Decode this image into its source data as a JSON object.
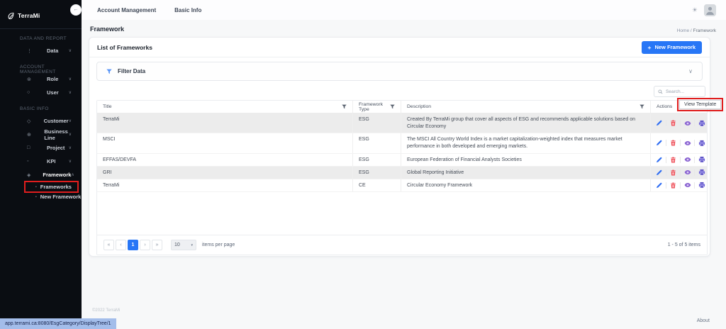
{
  "colors": {
    "accent": "#2776f6",
    "annotation": "#e01e1e",
    "edit": "#2f6df2",
    "delete": "#ee4b55",
    "view": "#8a63d2",
    "print": "#5f54c7",
    "status_bg": "#a3bdea"
  },
  "icons": {
    "collapse": "←",
    "theme": "☀",
    "chevron_down": "∨",
    "chevron_up": "∧",
    "filter_chevron": "∨",
    "caret": "▾",
    "scroll_up": "▲",
    "scroll_down": "▼",
    "sub_bullet": "•"
  },
  "sidebar": {
    "logo": "TerraMi",
    "sections": [
      {
        "label": "DATA AND REPORT",
        "items": [
          {
            "label": "Data",
            "icon": "data-icon",
            "glyph": "⋮",
            "chevron": "down"
          }
        ]
      },
      {
        "label": "ACCOUNT MANAGEMENT",
        "items": [
          {
            "label": "Role",
            "icon": "role-icon",
            "glyph": "⊚",
            "chevron": "down"
          },
          {
            "label": "User",
            "icon": "user-icon",
            "glyph": "○",
            "chevron": "down"
          }
        ]
      },
      {
        "label": "BASIC INFO",
        "items": [
          {
            "label": "Customer",
            "icon": "customer-icon",
            "glyph": "◇",
            "chevron": "down"
          },
          {
            "label": "Business Line",
            "icon": "business-line-icon",
            "glyph": "⊕",
            "chevron": "down"
          },
          {
            "label": "Project",
            "icon": "project-icon",
            "glyph": "□",
            "chevron": "down"
          },
          {
            "label": "KPI",
            "icon": "kpi-icon",
            "glyph": "◦",
            "chevron": "down"
          },
          {
            "label": "Framework",
            "icon": "framework-icon",
            "glyph": "◈",
            "chevron": "up",
            "active": true,
            "children": [
              {
                "label": "Frameworks",
                "annotated": true
              },
              {
                "label": "New Framework"
              }
            ]
          }
        ]
      }
    ]
  },
  "topbar": {
    "menu": [
      {
        "label": "Account Management"
      },
      {
        "label": "Basic Info"
      }
    ]
  },
  "page": {
    "title": "Framework",
    "breadcrumb_home": "Home",
    "breadcrumb_sep": " / ",
    "breadcrumb_current": "Framework"
  },
  "card": {
    "title": "List of Frameworks",
    "new_button_plus": "+",
    "new_button_label": "New Framework"
  },
  "filter": {
    "label": "Filter Data"
  },
  "search": {
    "placeholder": "Search..."
  },
  "table": {
    "columns": [
      {
        "label": "Title",
        "filter": true
      },
      {
        "label": "Framework Type",
        "filter": true
      },
      {
        "label": "Description",
        "filter": true
      },
      {
        "label": "Actions",
        "filter": false
      }
    ],
    "rows": [
      {
        "title": "TerraMi",
        "type": "ESG",
        "description": "Created By TerraMi group that cover all aspects of ESG and recommends applicable solutions based on Circular Economy",
        "shaded": true
      },
      {
        "title": "MSCI",
        "type": "ESG",
        "description": "The MSCI All Country World Index is a market capitalization-weighted index that measures market performance in both developed and emerging markets.",
        "shaded": false
      },
      {
        "title": "EFFAS/DEVFA",
        "type": "ESG",
        "description": "European Federation of Financial Analysts Societies",
        "shaded": false
      },
      {
        "title": "GRI",
        "type": "ESG",
        "description": "Global Reporting Initiative",
        "shaded": true
      },
      {
        "title": "TerraMi",
        "type": "CE",
        "description": "Circular Economy Framework",
        "shaded": false
      }
    ]
  },
  "tooltip": {
    "label": "View Template"
  },
  "pagination": {
    "first": "«",
    "prev": "‹",
    "page": "1",
    "next": "›",
    "last": "»",
    "page_size": "10",
    "items_label": "items per page",
    "range_label": "1 - 5 of 5 items"
  },
  "footer": {
    "copyright": "©2022 TerraMi",
    "about": "About"
  },
  "status_bar": {
    "link": "app.terrami.ca:8080/EsgCategory/DisplayTree/1"
  }
}
